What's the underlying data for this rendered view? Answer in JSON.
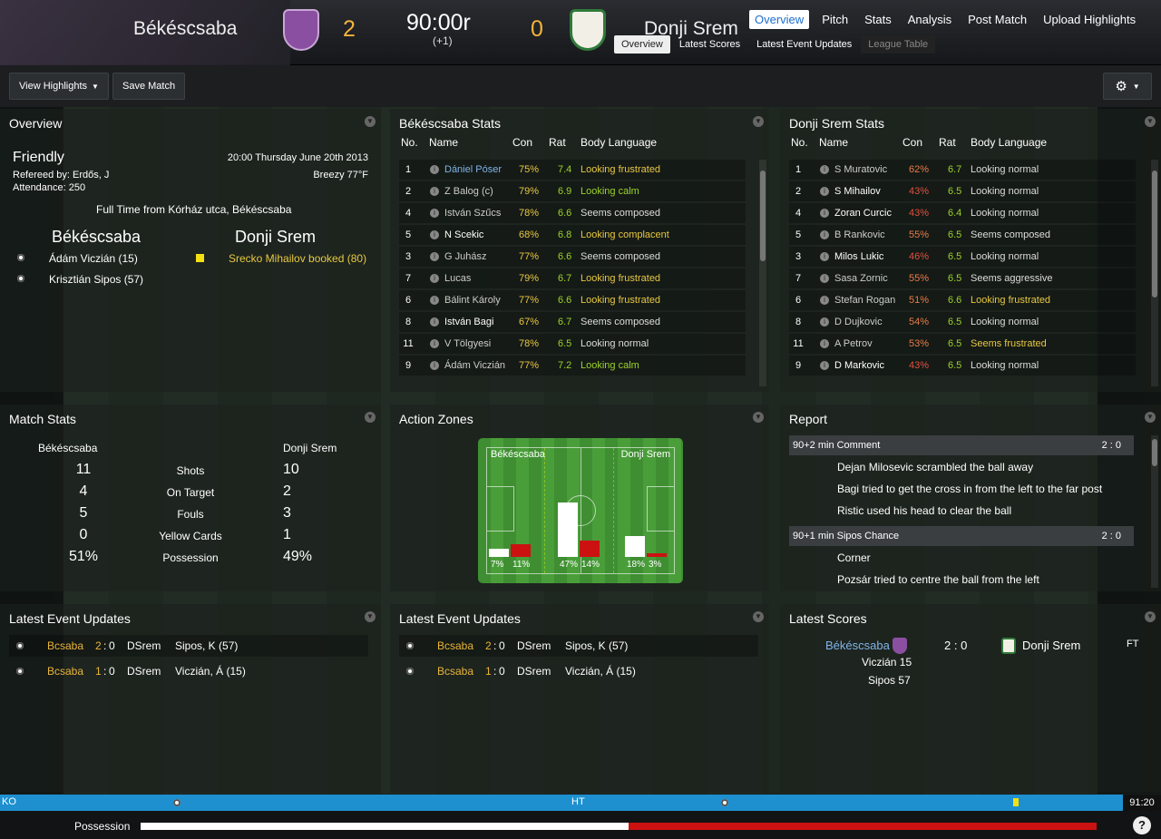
{
  "header": {
    "home_team": "Békéscsaba",
    "away_team": "Donji Srem",
    "home_score": "2",
    "away_score": "0",
    "clock": "90:00r",
    "added_time": "(+1)",
    "nav": [
      "Overview",
      "Pitch",
      "Stats",
      "Analysis",
      "Post Match",
      "Upload Highlights"
    ],
    "subnav": [
      "Overview",
      "Latest Scores",
      "Latest Event Updates",
      "League Table"
    ]
  },
  "toolbar": {
    "view_highlights": "View Highlights",
    "save_match": "Save Match"
  },
  "overview": {
    "title": "Overview",
    "match_type": "Friendly",
    "datetime": "20:00 Thursday June 20th 2013",
    "referee": "Refereed by: Erdős, J",
    "weather": "Breezy 77°F",
    "attendance": "Attendance: 250",
    "full_time": "Full Time from Kórház utca, Békéscsaba",
    "home": "Békéscsaba",
    "away": "Donji Srem",
    "home_events": [
      "Ádám Viczián (15)",
      "Krisztián Sipos (57)"
    ],
    "away_events": [
      "Srecko Mihailov booked (80)"
    ]
  },
  "stats_headers": {
    "no": "No.",
    "name": "Name",
    "con": "Con",
    "rat": "Rat",
    "bl": "Body Language"
  },
  "home_stats": {
    "title": "Békéscsaba Stats",
    "rows": [
      {
        "no": "1",
        "name": "Dániel Póser",
        "con": "75%",
        "rat": "7.4",
        "bl": "Looking frustrated",
        "nc": "#7fb3e6",
        "cc": "#e8c840",
        "bc": "#e8c840"
      },
      {
        "no": "2",
        "name": "Z Balog (c)",
        "con": "79%",
        "rat": "6.9",
        "bl": "Looking calm",
        "nc": "#ccc",
        "cc": "#e8c840",
        "bc": "#9cd42a"
      },
      {
        "no": "4",
        "name": "István Szűcs",
        "con": "78%",
        "rat": "6.6",
        "bl": "Seems composed",
        "nc": "#ccc",
        "cc": "#e8c840",
        "bc": "#ddd"
      },
      {
        "no": "5",
        "name": "N Scekic",
        "con": "68%",
        "rat": "6.8",
        "bl": "Looking complacent",
        "nc": "#fff",
        "cc": "#e8c840",
        "bc": "#e8c840"
      },
      {
        "no": "3",
        "name": "G Juhász",
        "con": "77%",
        "rat": "6.6",
        "bl": "Seems composed",
        "nc": "#ccc",
        "cc": "#e8c840",
        "bc": "#ddd"
      },
      {
        "no": "7",
        "name": "Lucas",
        "con": "79%",
        "rat": "6.7",
        "bl": "Looking frustrated",
        "nc": "#ccc",
        "cc": "#e8c840",
        "bc": "#e8c840"
      },
      {
        "no": "6",
        "name": "Bálint Károly",
        "con": "77%",
        "rat": "6.6",
        "bl": "Looking frustrated",
        "nc": "#ccc",
        "cc": "#e8c840",
        "bc": "#e8c840"
      },
      {
        "no": "8",
        "name": "István Bagi",
        "con": "67%",
        "rat": "6.7",
        "bl": "Seems composed",
        "nc": "#fff",
        "cc": "#e8c840",
        "bc": "#ddd"
      },
      {
        "no": "11",
        "name": "V Tölgyesi",
        "con": "78%",
        "rat": "6.5",
        "bl": "Looking normal",
        "nc": "#ccc",
        "cc": "#e8c840",
        "bc": "#ddd"
      },
      {
        "no": "9",
        "name": "Ádám Viczián",
        "con": "77%",
        "rat": "7.2",
        "bl": "Looking calm",
        "nc": "#ccc",
        "cc": "#e8c840",
        "bc": "#9cd42a"
      }
    ]
  },
  "away_stats": {
    "title": "Donji Srem Stats",
    "rows": [
      {
        "no": "1",
        "name": "S Muratovic",
        "con": "62%",
        "rat": "6.7",
        "bl": "Looking normal",
        "nc": "#ccc",
        "cc": "#e87c4a",
        "bc": "#ddd"
      },
      {
        "no": "2",
        "name": "S Mihailov",
        "con": "43%",
        "rat": "6.5",
        "bl": "Looking normal",
        "nc": "#fff",
        "cc": "#e05040",
        "bc": "#ddd"
      },
      {
        "no": "4",
        "name": "Zoran Curcic",
        "con": "43%",
        "rat": "6.4",
        "bl": "Looking normal",
        "nc": "#fff",
        "cc": "#e05040",
        "bc": "#ddd"
      },
      {
        "no": "5",
        "name": "B Rankovic",
        "con": "55%",
        "rat": "6.5",
        "bl": "Seems composed",
        "nc": "#ccc",
        "cc": "#e87c4a",
        "bc": "#ddd"
      },
      {
        "no": "3",
        "name": "Milos Lukic",
        "con": "46%",
        "rat": "6.5",
        "bl": "Looking normal",
        "nc": "#fff",
        "cc": "#e05040",
        "bc": "#ddd"
      },
      {
        "no": "7",
        "name": "Sasa Zornic",
        "con": "55%",
        "rat": "6.5",
        "bl": "Seems aggressive",
        "nc": "#ccc",
        "cc": "#e87c4a",
        "bc": "#ddd"
      },
      {
        "no": "6",
        "name": "Stefan Rogan",
        "con": "51%",
        "rat": "6.6",
        "bl": "Looking frustrated",
        "nc": "#ccc",
        "cc": "#e87c4a",
        "bc": "#e8c840"
      },
      {
        "no": "8",
        "name": "D Dujkovic",
        "con": "54%",
        "rat": "6.5",
        "bl": "Looking normal",
        "nc": "#ccc",
        "cc": "#e87c4a",
        "bc": "#ddd"
      },
      {
        "no": "11",
        "name": "A Petrov",
        "con": "53%",
        "rat": "6.5",
        "bl": "Seems frustrated",
        "nc": "#ccc",
        "cc": "#e87c4a",
        "bc": "#e8c840"
      },
      {
        "no": "9",
        "name": "D Markovic",
        "con": "43%",
        "rat": "6.5",
        "bl": "Looking normal",
        "nc": "#fff",
        "cc": "#e05040",
        "bc": "#ddd"
      }
    ]
  },
  "match_stats": {
    "title": "Match Stats",
    "home": "Békéscsaba",
    "away": "Donji Srem",
    "rows": [
      {
        "label": "Shots",
        "home": "11",
        "away": "10"
      },
      {
        "label": "On Target",
        "home": "4",
        "away": "2"
      },
      {
        "label": "Fouls",
        "home": "5",
        "away": "3"
      },
      {
        "label": "Yellow Cards",
        "home": "0",
        "away": "1"
      },
      {
        "label": "Possession",
        "home": "51%",
        "away": "49%"
      }
    ]
  },
  "action_zones": {
    "title": "Action Zones",
    "home": "Békéscsaba",
    "away": "Donji Srem",
    "zones": [
      {
        "home": 7,
        "away": 11,
        "home_label": "7%",
        "away_label": "11%"
      },
      {
        "home": 47,
        "away": 14,
        "home_label": "47%",
        "away_label": "14%"
      },
      {
        "home": 18,
        "away": 3,
        "home_label": "18%",
        "away_label": "3%"
      }
    ]
  },
  "report": {
    "title": "Report",
    "blocks": [
      {
        "head": "90+2 min Comment",
        "score": "2 : 0",
        "lines": [
          "Dejan Milosevic scrambled the ball away",
          "Bagi tried to get the cross in from the left to the far post",
          "Ristic used his head to clear the ball"
        ]
      },
      {
        "head": "90+1 min Sipos Chance",
        "score": "2 : 0",
        "lines": [
          "Corner",
          "Pozsár tried to centre the ball from the left"
        ]
      }
    ]
  },
  "event_updates": {
    "title": "Latest Event Updates",
    "rows": [
      {
        "team": "Bcsaba",
        "hs": "2",
        "sep": ":",
        "as": "0",
        "opp": "DSrem",
        "desc": "Sipos, K (57)"
      },
      {
        "team": "Bcsaba",
        "hs": "1",
        "sep": ":",
        "as": "0",
        "opp": "DSrem",
        "desc": "Viczián, Á (15)"
      }
    ]
  },
  "latest_scores": {
    "title": "Latest Scores",
    "home": "Békéscsaba",
    "score": "2 : 0",
    "away": "Donji Srem",
    "status": "FT",
    "scorers": [
      "Viczián 15",
      "Sipos 57"
    ]
  },
  "timeline": {
    "ko": "KO",
    "ht": "HT",
    "time": "91:20"
  },
  "possession": {
    "label": "Possession",
    "home_share": 0.51,
    "help": "?"
  },
  "colors": {
    "accent": "#f3b43a",
    "link": "#7fb3e6",
    "home_bar": "#ffffff",
    "away_bar": "#cc1111",
    "timeline": "#1e90d0"
  }
}
